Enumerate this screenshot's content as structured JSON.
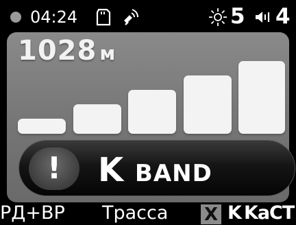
{
  "status": {
    "time": "04:24",
    "brightness": "5",
    "volume": "4"
  },
  "alert": {
    "distance": "1028",
    "distance_unit": "м",
    "signal_level_bars_active": 5,
    "band_letter": "K",
    "band_word": "BAND"
  },
  "modes": {
    "profile": "РД+ВР",
    "route": "Трасса",
    "disabled_band": "X",
    "band_k": "K",
    "band_ka": "Ka",
    "band_ct": "CT"
  },
  "icons": [
    "status-dot-icon",
    "sd-card-icon",
    "gps-signal-icon",
    "brightness-sun-icon",
    "speaker-icon",
    "warning-exclamation-icon"
  ]
}
